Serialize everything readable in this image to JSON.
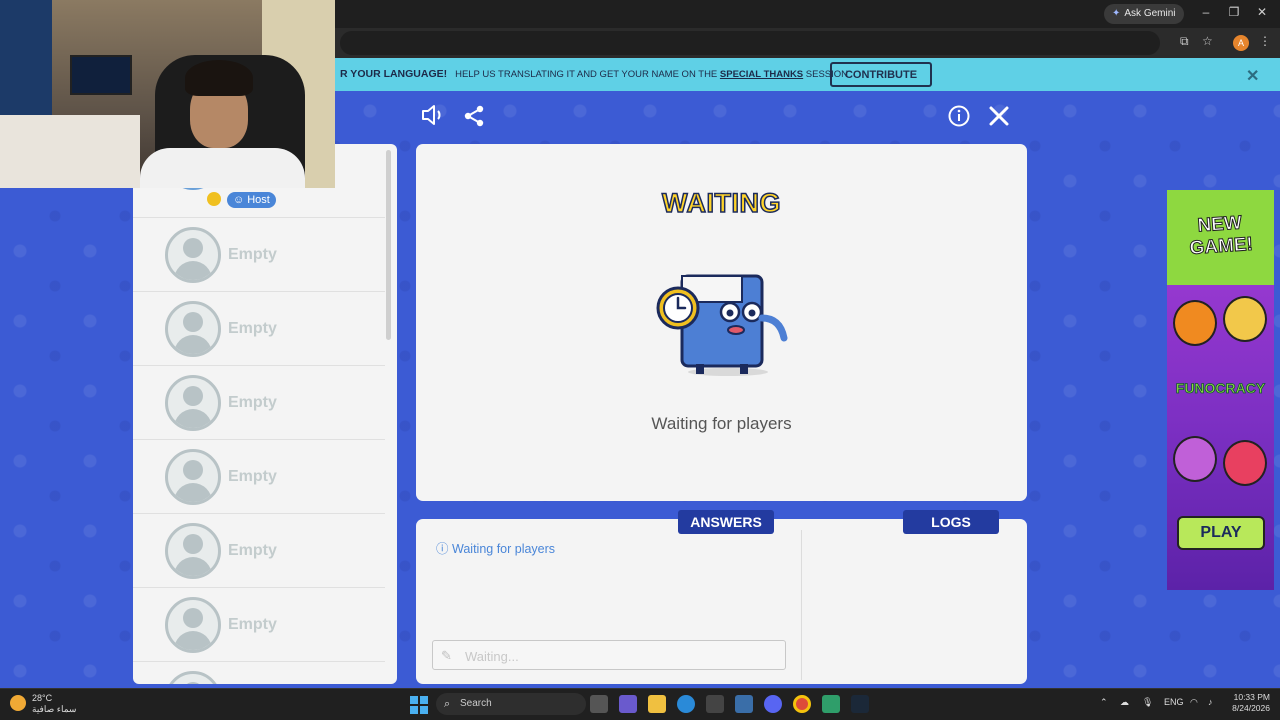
{
  "browser": {
    "ask_gemini": "Ask Gemini",
    "profile_initial": "A"
  },
  "banner": {
    "text_bold": "R YOUR LANGUAGE!",
    "text_main": "HELP US TRANSLATING IT AND GET YOUR NAME ON THE",
    "text_link": "SPECIAL THANKS",
    "text_end": "SESSION",
    "contribute_label": "CONTRIBUTE"
  },
  "players": {
    "host_label": "Host",
    "slots": [
      "Empty",
      "Empty",
      "Empty",
      "Empty",
      "Empty",
      "Empty"
    ]
  },
  "main": {
    "title": "WAITING",
    "subtitle": "Waiting for players"
  },
  "bottom": {
    "answers_tab": "ANSWERS",
    "logs_tab": "LOGS",
    "info_text": "Waiting for players",
    "input_placeholder": "Waiting..."
  },
  "ad": {
    "headline": "NEW GAME!",
    "brand": "FUNOCRACY",
    "play_label": "PLAY"
  },
  "taskbar": {
    "temperature": "28°C",
    "weather_desc": "سماء صافية",
    "search_label": "Search",
    "language": "ENG",
    "time": "10:33 PM",
    "date": "8/24/2026"
  },
  "colors": {
    "game_bg": "#3c5bd4",
    "banner": "#5fd0e6",
    "tab": "#233ba0",
    "title_yellow": "#ffd42a",
    "ad_green": "#8ed840"
  }
}
